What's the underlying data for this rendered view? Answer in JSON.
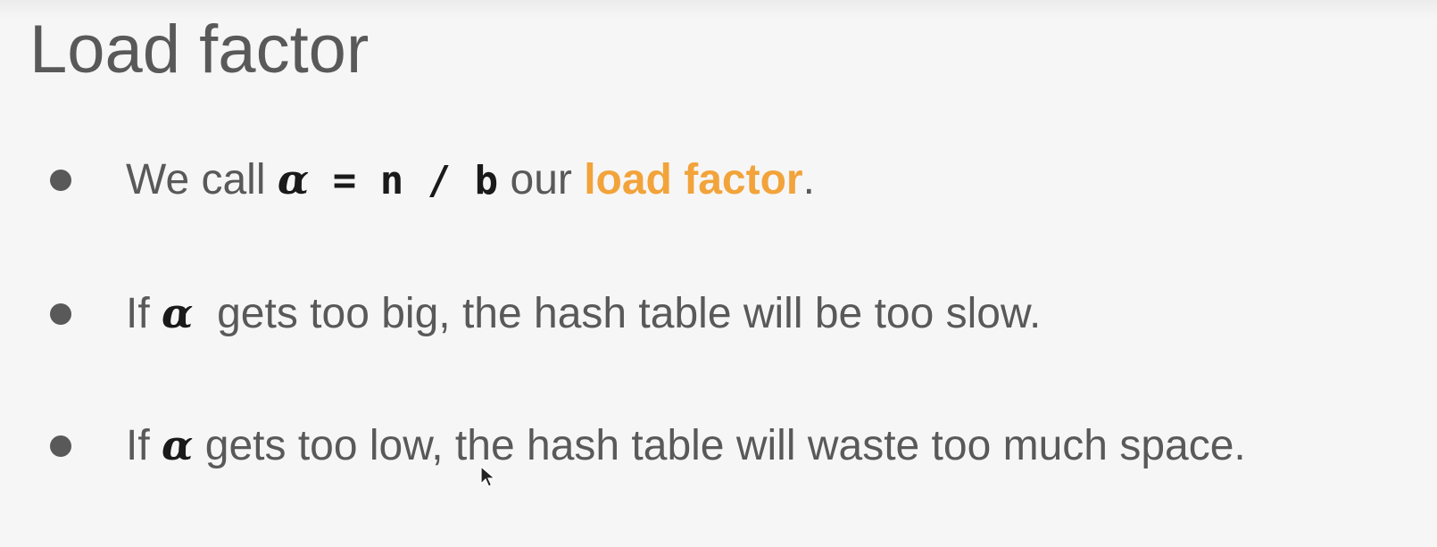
{
  "slide": {
    "title": "Load factor",
    "bullets": [
      {
        "prefix": "We call ",
        "symbol": "α",
        "formula": " = n / b",
        "middle": " our ",
        "highlight": "load factor",
        "suffix": "."
      },
      {
        "prefix": "If ",
        "symbol": "α",
        "suffix": "  gets too big, the hash table will be too slow."
      },
      {
        "prefix": "If ",
        "symbol": "α",
        "suffix": " gets too low, the hash table will waste too much space."
      }
    ]
  },
  "colors": {
    "background": "#f6f6f6",
    "text": "#595959",
    "math": "#1a1a1a",
    "accent": "#f2a33a"
  },
  "icons": {
    "bullet": "bullet-dot-icon",
    "cursor": "mouse-pointer-icon"
  }
}
